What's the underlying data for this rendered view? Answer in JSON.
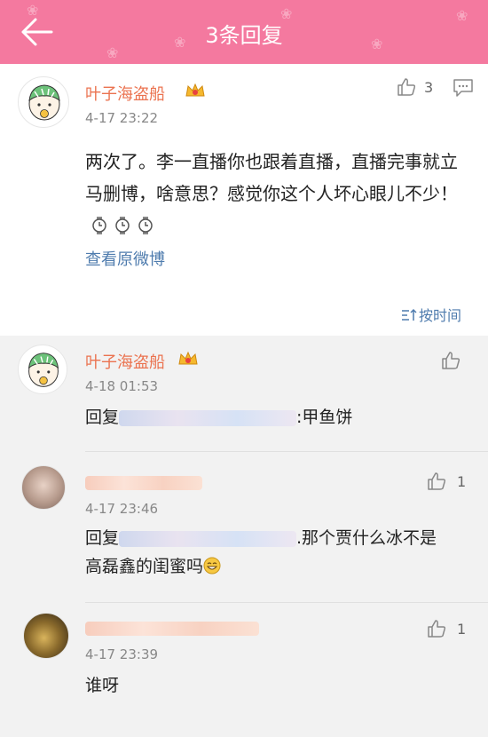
{
  "header": {
    "title": "3条回复",
    "back_icon": "back-arrow-icon"
  },
  "colors": {
    "header": "#f4799f",
    "username": "#eb7350",
    "link": "#4f7cae"
  },
  "main_comment": {
    "username": "叶子海盗船",
    "time": "4-17 23:22",
    "like_count": "3",
    "text": "两次了。李一直播你也跟着直播，直播完事就立马删博，啥意思？感觉你这个人坏心眼儿不少！",
    "view_original": "查看原微博"
  },
  "sort": {
    "label": "按时间"
  },
  "replies": [
    {
      "username": "叶子海盗船",
      "time": "4-18 01:53",
      "like_count": "",
      "prefix": "回复",
      "text": ":甲鱼饼"
    },
    {
      "username": "",
      "time": "4-17 23:46",
      "like_count": "1",
      "prefix": "回复",
      "text": ".那个贾什么冰不是",
      "text2": "高磊鑫的闺蜜吗"
    },
    {
      "username": "",
      "time": "4-17 23:39",
      "like_count": "1",
      "prefix": "",
      "text": "谁呀"
    }
  ]
}
